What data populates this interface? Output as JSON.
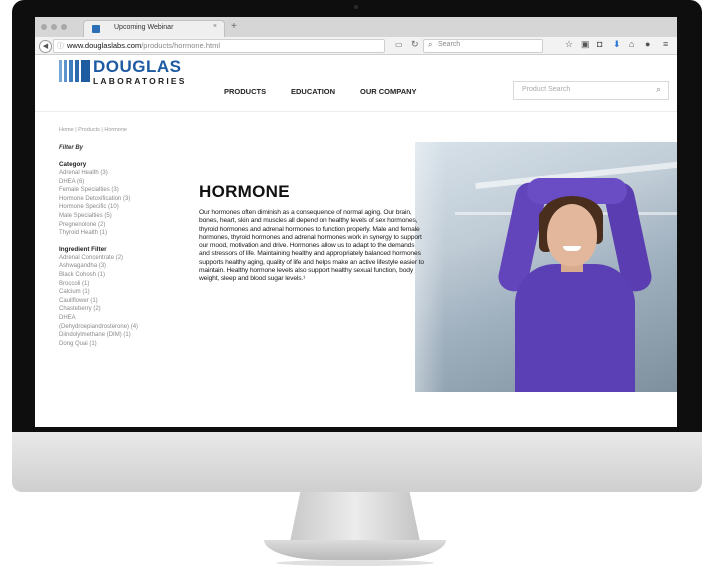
{
  "browser": {
    "tab_title": "Upcoming Webinar",
    "tab_close": "×",
    "new_tab": "+",
    "url_info_glyph": "ⓘ",
    "url_domain": "www.douglaslabs.com",
    "url_path": "/products/hormone.html",
    "search_placeholder": "Search",
    "icons": [
      "reader-view-icon",
      "reload-icon",
      "star-icon",
      "clipboard-icon",
      "pocket-icon",
      "download-icon",
      "home-icon",
      "chat-icon",
      "menu-icon"
    ]
  },
  "site": {
    "logo_top": "DOUGLAS",
    "logo_bottom": "LABORATORIES",
    "nav": [
      "PRODUCTS",
      "EDUCATION",
      "OUR COMPANY"
    ],
    "product_search_placeholder": "Product Search",
    "brand_color": "#1e5aa2"
  },
  "breadcrumb": "Home | Products | Hormone",
  "sidebar": {
    "filter_by": "Filter By",
    "category_title": "Category",
    "categories": [
      "Adrenal Health (3)",
      "DHEA (6)",
      "Female Specialties (3)",
      "Hormone Detoxification (3)",
      "Hormone Specific (10)",
      "Male Specialties (5)",
      "Pregnenolone (2)",
      "Thyroid Health (1)"
    ],
    "ingredient_title": "Ingredient Filter",
    "ingredients": [
      "Adrenal Concentrate (2)",
      "Ashwagandha (3)",
      "Black Cohosh (1)",
      "Broccoli (1)",
      "Calcium (1)",
      "Cauliflower (1)",
      "Chasteberry (2)",
      "DHEA",
      "(Dehydroepiandrosterone) (4)",
      "Diindolylmethane (DIM) (1)",
      "Dong Quai (1)"
    ]
  },
  "main": {
    "title": "HORMONE",
    "body": "Our hormones often diminish as a consequence of normal aging. Our brain, bones, heart, skin and muscles all depend on healthy levels of sex hormones, thyroid hormones and adrenal hormones to function properly. Male and female hormones, thyroid hormones and adrenal hormones work in synergy to support our mood, motivation and drive. Hormones allow us to adapt to the demands and stressors of life. Maintaining healthy and appropriately balanced hormones supports healthy aging, quality of life and helps make an active lifestyle easier to maintain. Healthy hormone levels also support healthy sexual function, body weight, sleep and blood sugar levels.¹",
    "photo_accent": "#5b3fb4"
  }
}
